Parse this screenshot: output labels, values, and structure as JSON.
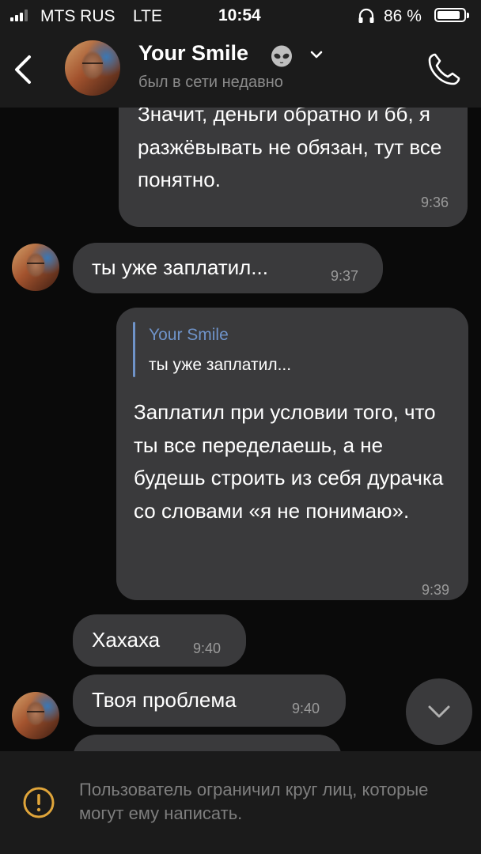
{
  "status_bar": {
    "carrier": "MTS RUS",
    "network": "LTE",
    "time": "10:54",
    "battery_percent": "86 %",
    "battery_level": 0.86
  },
  "header": {
    "contact_name": "Your Smile",
    "contact_status": "был в сети недавно",
    "name_emoji_icon": "alien-icon",
    "back_icon": "chevron-left-icon",
    "call_icon": "phone-icon"
  },
  "messages": [
    {
      "direction": "outgoing",
      "text": "Значит, деньги обратно и бб, я разжёвывать не обязан, тут все понятно.",
      "time": "9:36"
    },
    {
      "direction": "incoming",
      "text": "ты уже заплатил...",
      "time": "9:37"
    },
    {
      "direction": "outgoing",
      "reply_to": {
        "author": "Your Smile",
        "text": "ты уже заплатил..."
      },
      "text": "Заплатил при условии того, что ты все переделаешь, а не будешь строить из себя дурачка со словами «я не понимаю».",
      "time": "9:39"
    },
    {
      "direction": "incoming",
      "text": "Хахаха",
      "time": "9:40"
    },
    {
      "direction": "incoming",
      "text": "Твоя проблема",
      "time": "9:40"
    }
  ],
  "restriction_banner": {
    "icon": "warning-icon",
    "text": "Пользователь ограничил круг лиц, которые могут ему написать."
  },
  "colors": {
    "background": "#0a0a0a",
    "bar_background": "#1b1b1b",
    "bubble": "#3a3a3c",
    "reply_accent": "#6f93c9",
    "warning": "#e0a53a"
  }
}
